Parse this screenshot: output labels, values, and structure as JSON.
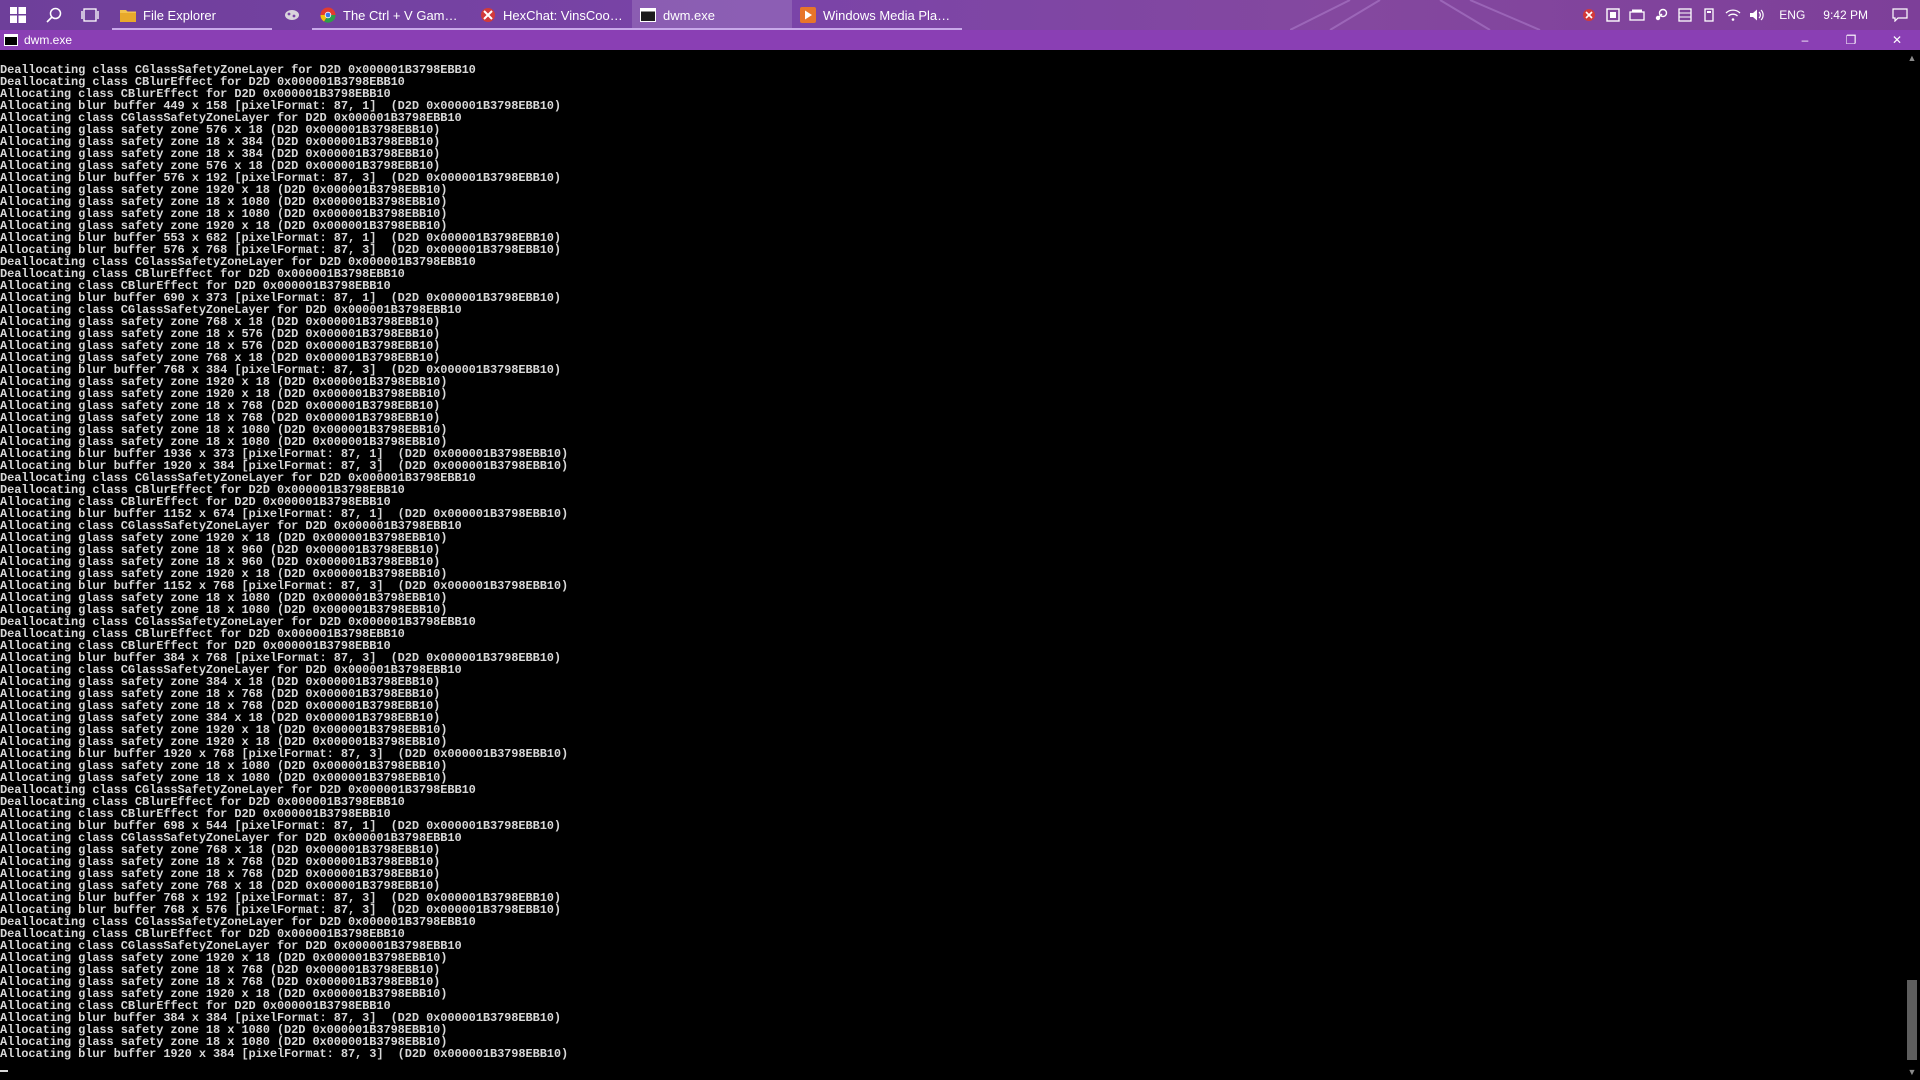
{
  "taskbar": {
    "start_icon": "windows-logo-icon",
    "search_icon": "search-icon",
    "taskview_icon": "task-view-icon",
    "apps": [
      {
        "label": "File Explorer",
        "icon": "folder-icon",
        "running": true,
        "active": false
      },
      {
        "label": "",
        "icon": "mixer-icon",
        "running": false,
        "active": false
      },
      {
        "label": "The Ctrl + V Game | P...",
        "icon": "browser-icon",
        "running": true,
        "active": false
      },
      {
        "label": "HexChat: VinsCool @ ...",
        "icon": "hexchat-icon",
        "running": true,
        "active": false
      },
      {
        "label": "dwm.exe",
        "icon": "console-icon",
        "running": true,
        "active": true
      },
      {
        "label": "Windows Media Player",
        "icon": "media-player-icon",
        "running": true,
        "active": false
      }
    ],
    "tray": {
      "language": "ENG",
      "time": "9:42 PM"
    }
  },
  "window": {
    "title": "dwm.exe",
    "minimize": "–",
    "restore": "❐",
    "close": "✕"
  },
  "console": {
    "lines": [
      "Deallocating class CGlassSafetyZoneLayer for D2D 0x000001B3798EBB10",
      "Deallocating class CBlurEffect for D2D 0x000001B3798EBB10",
      "Allocating class CBlurEffect for D2D 0x000001B3798EBB10",
      "Allocating blur buffer 449 x 158 [pixelFormat: 87, 1]  (D2D 0x000001B3798EBB10)",
      "Allocating class CGlassSafetyZoneLayer for D2D 0x000001B3798EBB10",
      "Allocating glass safety zone 576 x 18 (D2D 0x000001B3798EBB10)",
      "Allocating glass safety zone 18 x 384 (D2D 0x000001B3798EBB10)",
      "Allocating glass safety zone 18 x 384 (D2D 0x000001B3798EBB10)",
      "Allocating glass safety zone 576 x 18 (D2D 0x000001B3798EBB10)",
      "Allocating blur buffer 576 x 192 [pixelFormat: 87, 3]  (D2D 0x000001B3798EBB10)",
      "Allocating glass safety zone 1920 x 18 (D2D 0x000001B3798EBB10)",
      "Allocating glass safety zone 18 x 1080 (D2D 0x000001B3798EBB10)",
      "Allocating glass safety zone 18 x 1080 (D2D 0x000001B3798EBB10)",
      "Allocating glass safety zone 1920 x 18 (D2D 0x000001B3798EBB10)",
      "Allocating blur buffer 553 x 682 [pixelFormat: 87, 1]  (D2D 0x000001B3798EBB10)",
      "Allocating blur buffer 576 x 768 [pixelFormat: 87, 3]  (D2D 0x000001B3798EBB10)",
      "Deallocating class CGlassSafetyZoneLayer for D2D 0x000001B3798EBB10",
      "Deallocating class CBlurEffect for D2D 0x000001B3798EBB10",
      "Allocating class CBlurEffect for D2D 0x000001B3798EBB10",
      "Allocating blur buffer 690 x 373 [pixelFormat: 87, 1]  (D2D 0x000001B3798EBB10)",
      "Allocating class CGlassSafetyZoneLayer for D2D 0x000001B3798EBB10",
      "Allocating glass safety zone 768 x 18 (D2D 0x000001B3798EBB10)",
      "Allocating glass safety zone 18 x 576 (D2D 0x000001B3798EBB10)",
      "Allocating glass safety zone 18 x 576 (D2D 0x000001B3798EBB10)",
      "Allocating glass safety zone 768 x 18 (D2D 0x000001B3798EBB10)",
      "Allocating blur buffer 768 x 384 [pixelFormat: 87, 3]  (D2D 0x000001B3798EBB10)",
      "Allocating glass safety zone 1920 x 18 (D2D 0x000001B3798EBB10)",
      "Allocating glass safety zone 1920 x 18 (D2D 0x000001B3798EBB10)",
      "Allocating glass safety zone 18 x 768 (D2D 0x000001B3798EBB10)",
      "Allocating glass safety zone 18 x 768 (D2D 0x000001B3798EBB10)",
      "Allocating glass safety zone 18 x 1080 (D2D 0x000001B3798EBB10)",
      "Allocating glass safety zone 18 x 1080 (D2D 0x000001B3798EBB10)",
      "Allocating blur buffer 1936 x 373 [pixelFormat: 87, 1]  (D2D 0x000001B3798EBB10)",
      "Allocating blur buffer 1920 x 384 [pixelFormat: 87, 3]  (D2D 0x000001B3798EBB10)",
      "Deallocating class CGlassSafetyZoneLayer for D2D 0x000001B3798EBB10",
      "Deallocating class CBlurEffect for D2D 0x000001B3798EBB10",
      "Allocating class CBlurEffect for D2D 0x000001B3798EBB10",
      "Allocating blur buffer 1152 x 674 [pixelFormat: 87, 1]  (D2D 0x000001B3798EBB10)",
      "Allocating class CGlassSafetyZoneLayer for D2D 0x000001B3798EBB10",
      "Allocating glass safety zone 1920 x 18 (D2D 0x000001B3798EBB10)",
      "Allocating glass safety zone 18 x 960 (D2D 0x000001B3798EBB10)",
      "Allocating glass safety zone 18 x 960 (D2D 0x000001B3798EBB10)",
      "Allocating glass safety zone 1920 x 18 (D2D 0x000001B3798EBB10)",
      "Allocating blur buffer 1152 x 768 [pixelFormat: 87, 3]  (D2D 0x000001B3798EBB10)",
      "Allocating glass safety zone 18 x 1080 (D2D 0x000001B3798EBB10)",
      "Allocating glass safety zone 18 x 1080 (D2D 0x000001B3798EBB10)",
      "Deallocating class CGlassSafetyZoneLayer for D2D 0x000001B3798EBB10",
      "Deallocating class CBlurEffect for D2D 0x000001B3798EBB10",
      "Allocating class CBlurEffect for D2D 0x000001B3798EBB10",
      "Allocating blur buffer 384 x 768 [pixelFormat: 87, 3]  (D2D 0x000001B3798EBB10)",
      "Allocating class CGlassSafetyZoneLayer for D2D 0x000001B3798EBB10",
      "Allocating glass safety zone 384 x 18 (D2D 0x000001B3798EBB10)",
      "Allocating glass safety zone 18 x 768 (D2D 0x000001B3798EBB10)",
      "Allocating glass safety zone 18 x 768 (D2D 0x000001B3798EBB10)",
      "Allocating glass safety zone 384 x 18 (D2D 0x000001B3798EBB10)",
      "Allocating glass safety zone 1920 x 18 (D2D 0x000001B3798EBB10)",
      "Allocating glass safety zone 1920 x 18 (D2D 0x000001B3798EBB10)",
      "Allocating blur buffer 1920 x 768 [pixelFormat: 87, 3]  (D2D 0x000001B3798EBB10)",
      "Allocating glass safety zone 18 x 1080 (D2D 0x000001B3798EBB10)",
      "Allocating glass safety zone 18 x 1080 (D2D 0x000001B3798EBB10)",
      "Deallocating class CGlassSafetyZoneLayer for D2D 0x000001B3798EBB10",
      "Deallocating class CBlurEffect for D2D 0x000001B3798EBB10",
      "Allocating class CBlurEffect for D2D 0x000001B3798EBB10",
      "Allocating blur buffer 698 x 544 [pixelFormat: 87, 1]  (D2D 0x000001B3798EBB10)",
      "Allocating class CGlassSafetyZoneLayer for D2D 0x000001B3798EBB10",
      "Allocating glass safety zone 768 x 18 (D2D 0x000001B3798EBB10)",
      "Allocating glass safety zone 18 x 768 (D2D 0x000001B3798EBB10)",
      "Allocating glass safety zone 18 x 768 (D2D 0x000001B3798EBB10)",
      "Allocating glass safety zone 768 x 18 (D2D 0x000001B3798EBB10)",
      "Allocating blur buffer 768 x 192 [pixelFormat: 87, 3]  (D2D 0x000001B3798EBB10)",
      "Allocating blur buffer 768 x 576 [pixelFormat: 87, 3]  (D2D 0x000001B3798EBB10)",
      "Deallocating class CGlassSafetyZoneLayer for D2D 0x000001B3798EBB10",
      "Deallocating class CBlurEffect for D2D 0x000001B3798EBB10",
      "Allocating class CGlassSafetyZoneLayer for D2D 0x000001B3798EBB10",
      "Allocating glass safety zone 1920 x 18 (D2D 0x000001B3798EBB10)",
      "Allocating glass safety zone 18 x 768 (D2D 0x000001B3798EBB10)",
      "Allocating glass safety zone 18 x 768 (D2D 0x000001B3798EBB10)",
      "Allocating glass safety zone 1920 x 18 (D2D 0x000001B3798EBB10)",
      "Allocating class CBlurEffect for D2D 0x000001B3798EBB10",
      "Allocating blur buffer 384 x 384 [pixelFormat: 87, 3]  (D2D 0x000001B3798EBB10)",
      "Allocating glass safety zone 18 x 1080 (D2D 0x000001B3798EBB10)",
      "Allocating glass safety zone 18 x 1080 (D2D 0x000001B3798EBB10)",
      "Allocating blur buffer 1920 x 384 [pixelFormat: 87, 3]  (D2D 0x000001B3798EBB10)"
    ]
  },
  "colors": {
    "taskbar": "#7a44a8",
    "titlebar": "#8a3fb4",
    "console_bg": "#000000",
    "console_text": "#d8d8d8"
  }
}
